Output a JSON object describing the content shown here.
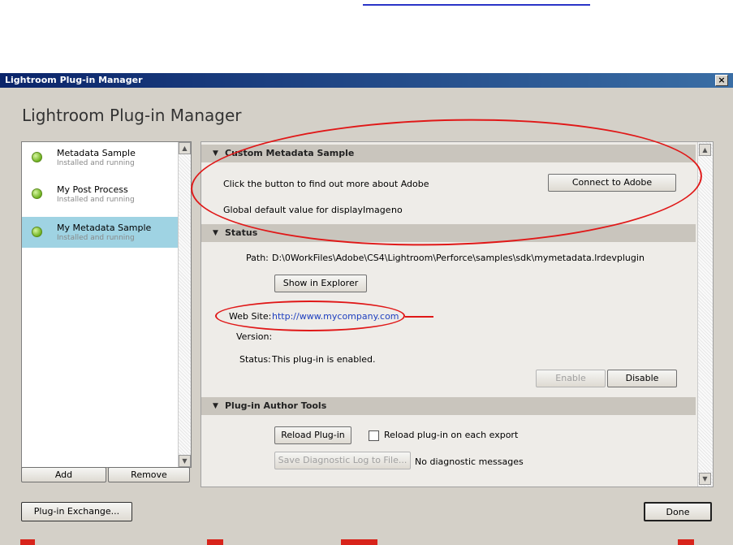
{
  "window": {
    "title": "Lightroom Plug-in Manager",
    "close_glyph": "×",
    "heading": "Lightroom Plug-in Manager"
  },
  "plugins": [
    {
      "name": "Metadata Sample",
      "status": "Installed and running",
      "selected": false
    },
    {
      "name": "My Post Process",
      "status": "Installed and running",
      "selected": false
    },
    {
      "name": "My Metadata Sample",
      "status": "Installed and running",
      "selected": true
    }
  ],
  "list_buttons": {
    "add": "Add",
    "remove": "Remove"
  },
  "sections": {
    "custom": {
      "title": "Custom Metadata Sample",
      "find_text": "Click the button to find out more about Adobe",
      "connect_button": "Connect to Adobe",
      "default_label": "Global default value for displayImage:",
      "default_value": "no"
    },
    "status": {
      "title": "Status",
      "path_label": "Path:",
      "path_value": "D:\\0WorkFiles\\Adobe\\CS4\\Lightroom\\Perforce\\samples\\sdk\\mymetadata.lrdevplugin",
      "show_button": "Show in Explorer",
      "website_label": "Web Site:",
      "website_value": "http://www.mycompany.com",
      "version_label": "Version:",
      "status_label": "Status:",
      "status_value": "This plug-in is enabled.",
      "enable_button": "Enable",
      "disable_button": "Disable"
    },
    "author": {
      "title": "Plug-in Author Tools",
      "reload_button": "Reload Plug-in",
      "reload_checkbox_label": "Reload plug-in on each export",
      "save_log_button": "Save Diagnostic Log to File...",
      "diag_text": "No diagnostic messages"
    }
  },
  "footer": {
    "exchange_button": "Plug-in Exchange...",
    "done_button": "Done"
  },
  "colors": {
    "accent_selection": "#9fd3e3",
    "annotation_red": "#e01818",
    "link": "#1e3fbf"
  }
}
